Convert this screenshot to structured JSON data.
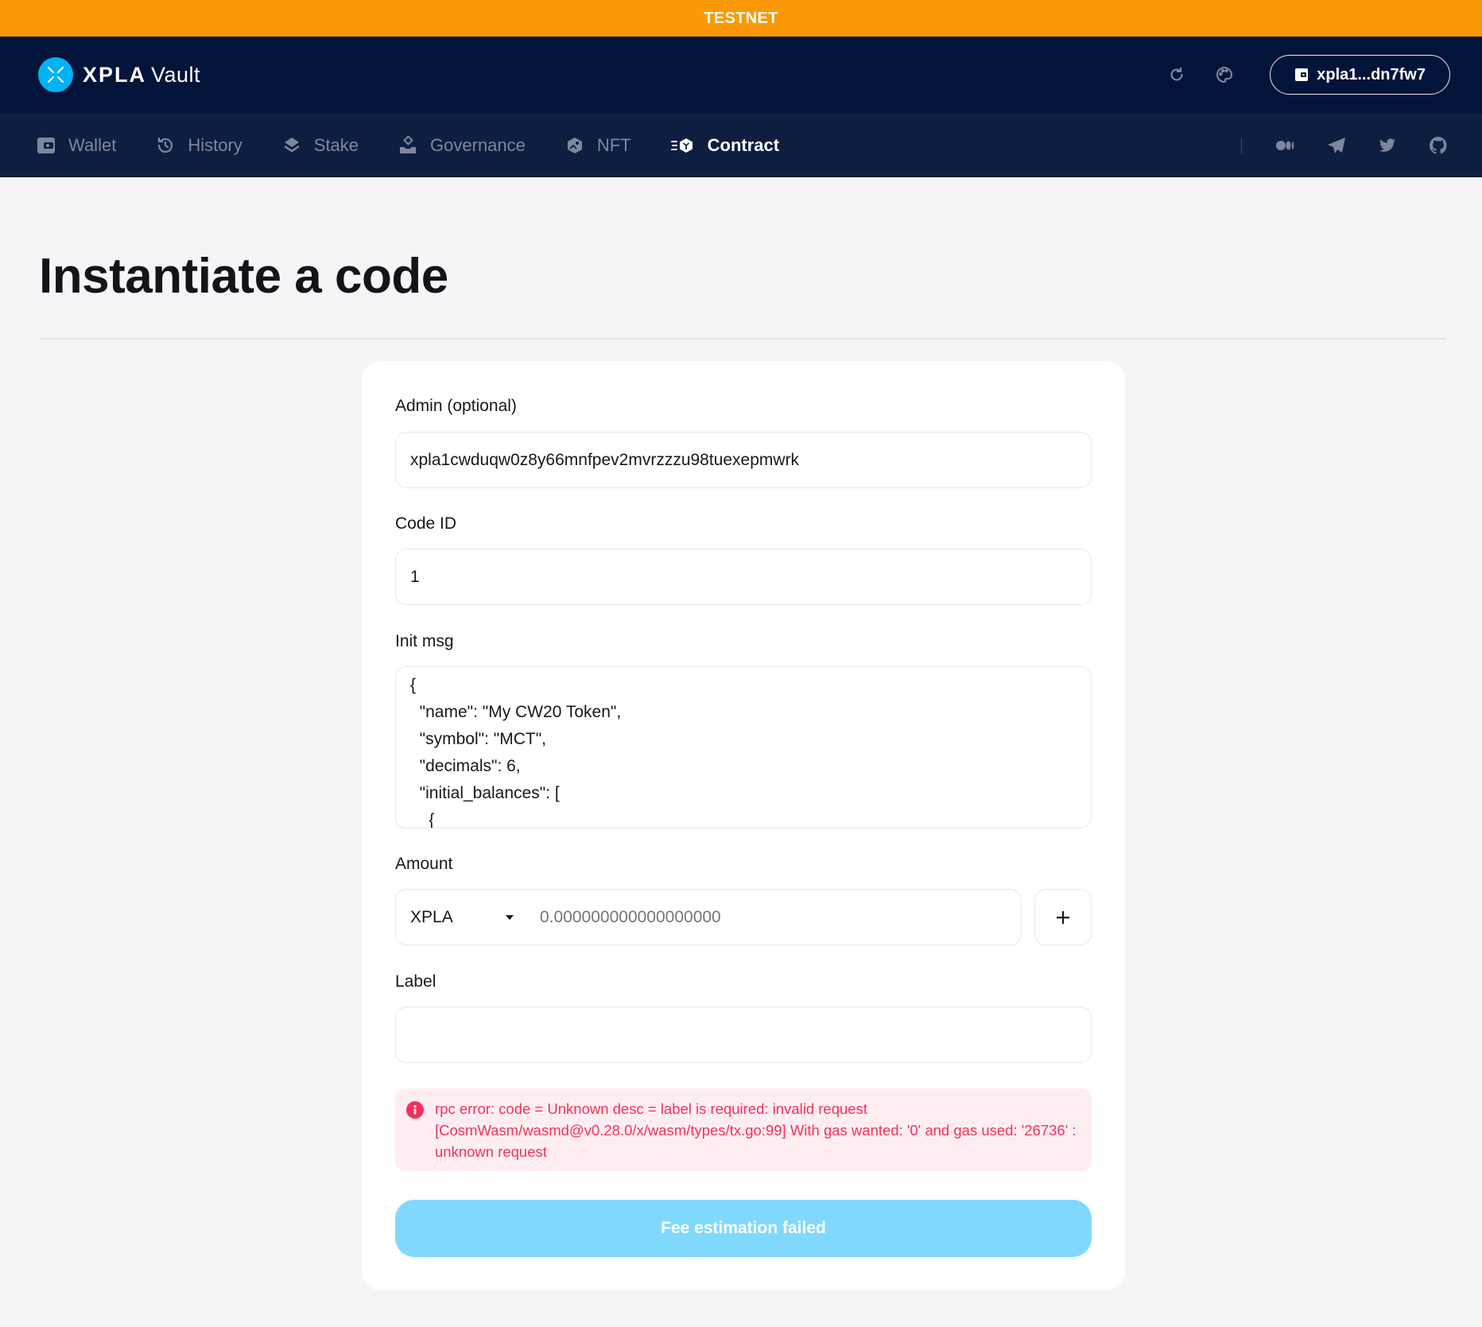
{
  "network_banner": "TESTNET",
  "header": {
    "brand": "XPLA",
    "product": "Vault",
    "wallet_address": "xpla1...dn7fw7",
    "icons": [
      "refresh-icon",
      "palette-icon",
      "wallet-icon"
    ]
  },
  "nav": {
    "items": [
      {
        "label": "Wallet",
        "icon": "wallet-icon",
        "active": false
      },
      {
        "label": "History",
        "icon": "history-icon",
        "active": false
      },
      {
        "label": "Stake",
        "icon": "stake-layers-icon",
        "active": false
      },
      {
        "label": "Governance",
        "icon": "governance-ballot-icon",
        "active": false
      },
      {
        "label": "NFT",
        "icon": "nft-icon",
        "active": false
      },
      {
        "label": "Contract",
        "icon": "contract-icon",
        "active": true
      }
    ],
    "social": [
      "medium-icon",
      "telegram-icon",
      "twitter-icon",
      "github-icon"
    ]
  },
  "page": {
    "title": "Instantiate a code"
  },
  "form": {
    "admin": {
      "label": "Admin (optional)",
      "value": "xpla1cwduqw0z8y66mnfpev2mvrzzzu98tuexepmwrk"
    },
    "code_id": {
      "label": "Code ID",
      "value": "1"
    },
    "init_msg": {
      "label": "Init msg",
      "value": "{\n  \"name\": \"My CW20 Token\",\n  \"symbol\": \"MCT\",\n  \"decimals\": 6,\n  \"initial_balances\": [\n    {"
    },
    "amount": {
      "label": "Amount",
      "denom": "XPLA",
      "placeholder": "0.000000000000000000",
      "add_label": "+"
    },
    "label": {
      "label": "Label",
      "value": ""
    },
    "error": {
      "message": "rpc error: code = Unknown desc = label is required: invalid request [CosmWasm/wasmd@v0.28.0/x/wasm/types/tx.go:99] With gas wanted: '0' and gas used: '26736' : unknown request"
    },
    "submit_label": "Fee estimation failed"
  },
  "colors": {
    "testnet": "#fb9805",
    "header_bg": "#03143a",
    "nav_bg": "#0e1e40",
    "accent": "#00b3f4",
    "button_disabled": "#80d9fd",
    "error": "#f5305b",
    "error_bg": "#ffeef1"
  }
}
